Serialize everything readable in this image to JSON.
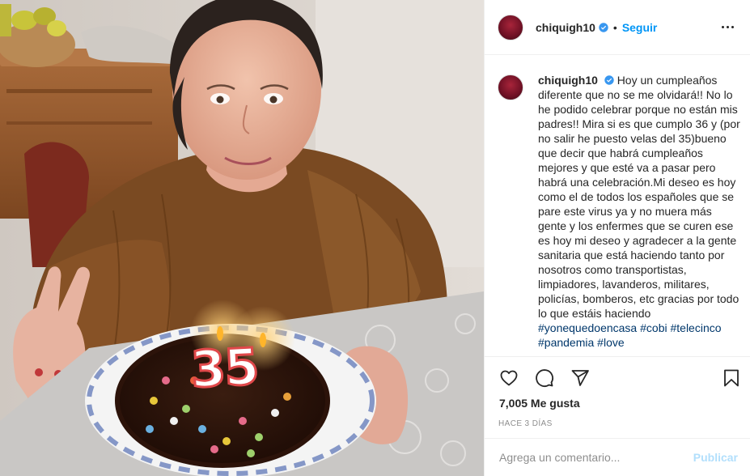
{
  "post": {
    "image": {
      "description_icon": "birthday-photo",
      "cake_number": "35"
    }
  },
  "header": {
    "username": "chiquigh10",
    "verified_icon": "verified-badge-icon",
    "separator": "•",
    "follow_label": "Seguir",
    "more_icon": "more-options-icon"
  },
  "caption": {
    "username": "chiquigh10",
    "text": "Hoy un cumpleaños diferente que no se me olvidará!! No lo he podido celebrar porque no están mis padres!! Mira si es que cumplo 36 y (por no salir he puesto velas del 35)bueno que decir que habrá cumpleaños mejores y que esté va a pasar pero habrá una celebración.Mi deseo es hoy como el de todos los españoles que se pare este virus ya y no muera más gente y los enfermes que se curen ese es hoy mi deseo y agradecer a la gente sanitaria que está haciendo tanto por nosotros como transportistas, limpiadores, lavanderos, militares, policías, bomberos, etc gracias por todo lo que estáis haciendo ",
    "hashtags": [
      "#yonequedoencasa",
      "#cobi",
      "#telecinco",
      "#pandemia",
      "#love"
    ]
  },
  "actions": {
    "icons": [
      "heart-icon",
      "comment-icon",
      "share-icon",
      "bookmark-icon"
    ]
  },
  "likes_text": "7,005 Me gusta",
  "time_ago": "HACE 3 DÍAS",
  "comment_box": {
    "placeholder": "Agrega un comentario...",
    "publish_label": "Publicar"
  },
  "colors": {
    "link_blue": "#0095f6",
    "publish_disabled": "#b2dffc",
    "hashtag": "#00376b",
    "verified": "#3897f0",
    "muted": "#8e8e8e"
  }
}
